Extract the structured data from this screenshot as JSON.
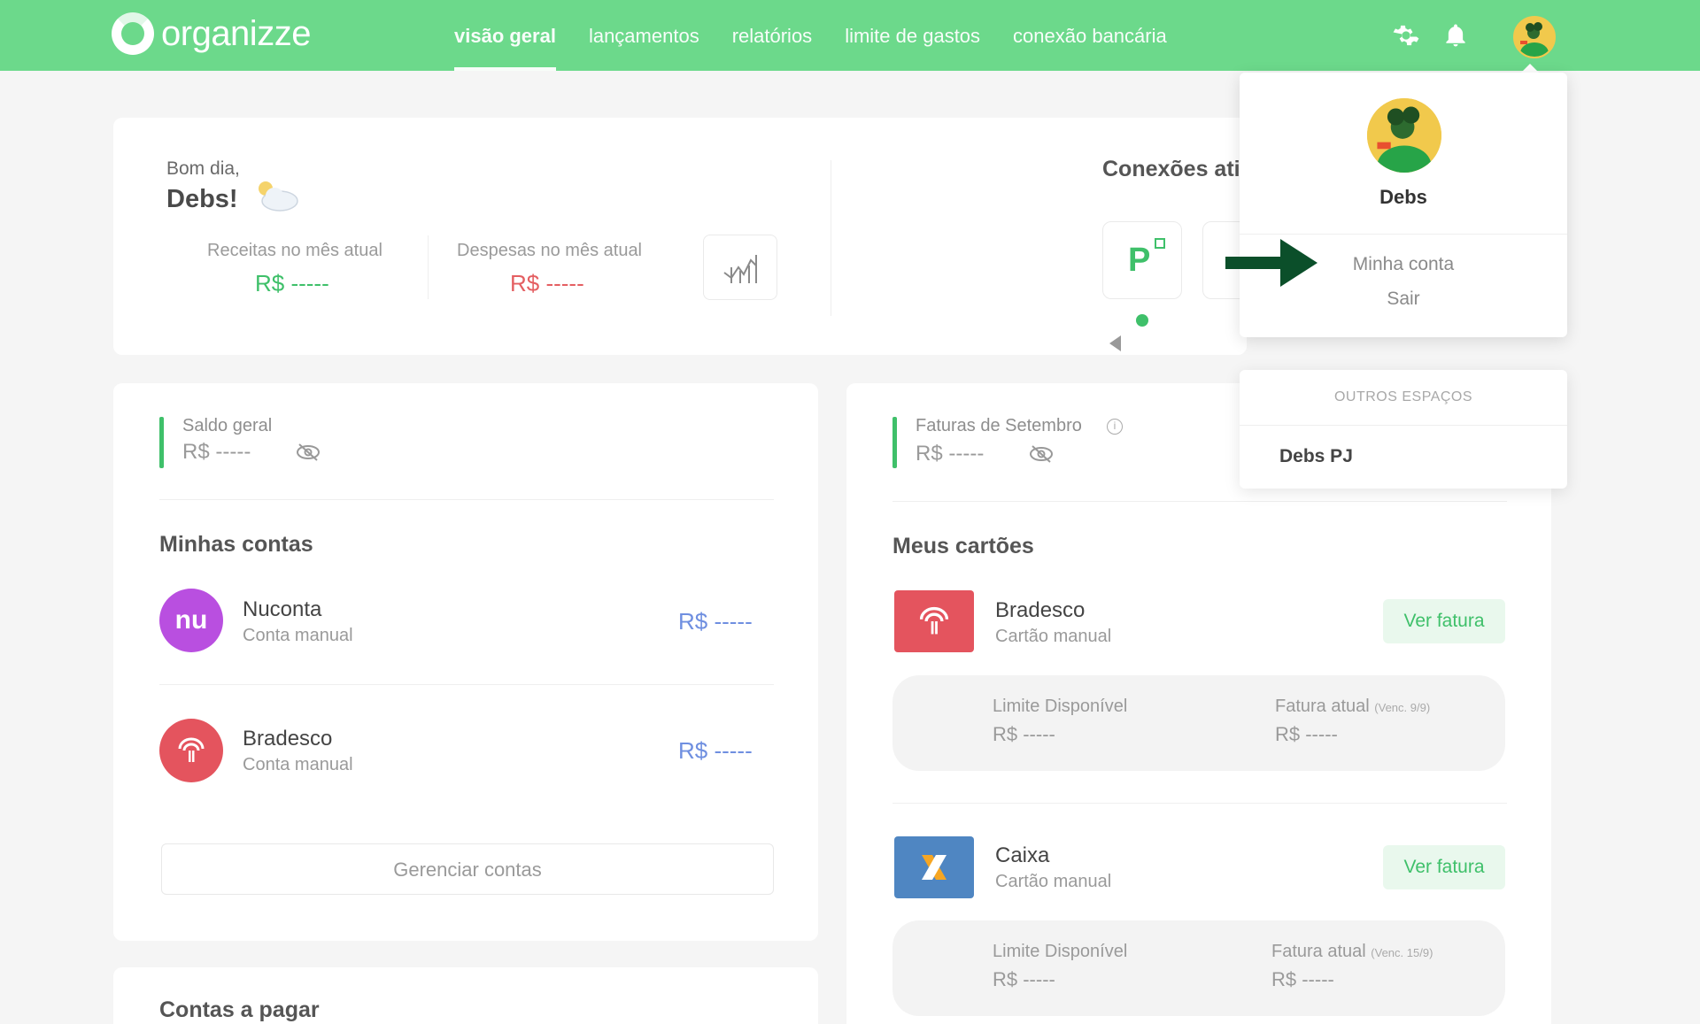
{
  "nav": {
    "brand": "organizze",
    "items": [
      {
        "label": "visão geral",
        "active": true
      },
      {
        "label": "lançamentos",
        "active": false
      },
      {
        "label": "relatórios",
        "active": false
      },
      {
        "label": "limite de gastos",
        "active": false
      },
      {
        "label": "conexão bancária",
        "active": false
      }
    ],
    "icons": [
      "gear-icon",
      "bell-icon",
      "avatar"
    ]
  },
  "summary": {
    "greeting": "Bom dia,",
    "name": "Debs!",
    "income_label": "Receitas no mês atual",
    "income_value": "R$ -----",
    "expense_label": "Despesas no mês atual",
    "expense_value": "R$ -----",
    "connections_title": "Conexões ati"
  },
  "accounts": {
    "balance_label": "Saldo geral",
    "balance_value": "R$ -----",
    "title": "Minhas contas",
    "items": [
      {
        "name": "Nuconta",
        "type": "Conta manual",
        "value": "R$ -----",
        "logo_text": "nu"
      },
      {
        "name": "Bradesco",
        "type": "Conta manual",
        "value": "R$ -----"
      }
    ],
    "manage_label": "Gerenciar contas",
    "payables_title": "Contas a pagar"
  },
  "cards": {
    "invoice_label": "Faturas de Setembro",
    "invoice_value": "R$ -----",
    "title": "Meus cartões",
    "items": [
      {
        "name": "Bradesco",
        "type": "Cartão manual",
        "button": "Ver fatura",
        "limit_label": "Limite Disponível",
        "limit_value": "R$ -----",
        "invoice_label": "Fatura atual",
        "due": "(Venc. 9/9)",
        "invoice_value": "R$ -----"
      },
      {
        "name": "Caixa",
        "type": "Cartão manual",
        "button": "Ver fatura",
        "limit_label": "Limite Disponível",
        "limit_value": "R$ -----",
        "invoice_label": "Fatura atual",
        "due": "(Venc. 15/9)",
        "invoice_value": "R$ -----"
      }
    ]
  },
  "dropdown": {
    "user": "Debs",
    "links": [
      "Minha conta",
      "Sair"
    ],
    "other_title": "OUTROS ESPAÇOS",
    "other_items": [
      "Debs PJ"
    ]
  },
  "colors": {
    "brand_green": "#6cd98b",
    "accent_green": "#3fc06a",
    "expense_red": "#e45f62",
    "value_blue": "#6f8fe0",
    "arrow_dark_green": "#0b4f2a"
  }
}
